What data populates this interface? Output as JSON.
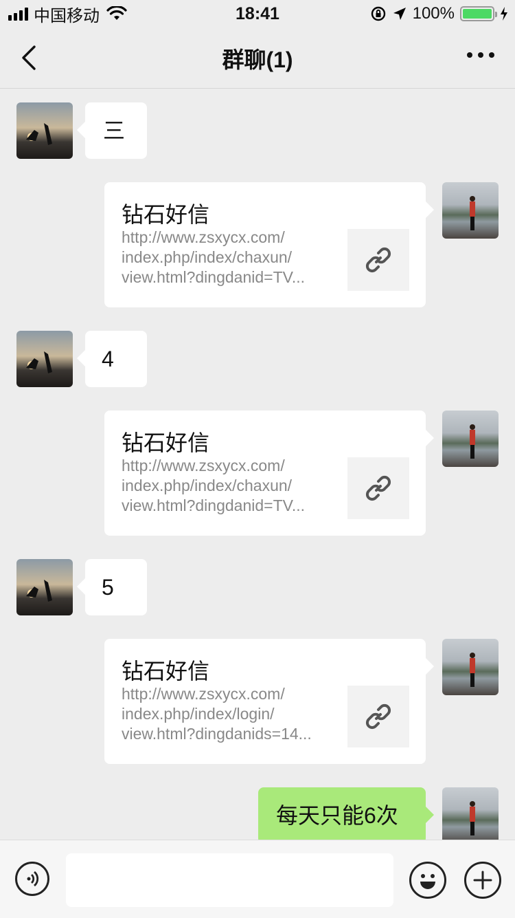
{
  "status_bar": {
    "carrier": "中国移动",
    "time": "18:41",
    "battery": "100%",
    "battery_level": 1.0
  },
  "nav": {
    "title": "群聊(1)"
  },
  "messages": [
    {
      "side": "left",
      "type": "text",
      "text": "三"
    },
    {
      "side": "right",
      "type": "link",
      "title": "钻石好信",
      "url_lines": [
        "http://www.zsxycx.com/",
        "index.php/index/chaxun/",
        "view.html?dingdanid=TV..."
      ]
    },
    {
      "side": "left",
      "type": "text",
      "text": "4"
    },
    {
      "side": "right",
      "type": "link",
      "title": "钻石好信",
      "url_lines": [
        "http://www.zsxycx.com/",
        "index.php/index/chaxun/",
        "view.html?dingdanid=TV..."
      ]
    },
    {
      "side": "left",
      "type": "text",
      "text": "5"
    },
    {
      "side": "right",
      "type": "link",
      "title": "钻石好信",
      "url_lines": [
        "http://www.zsxycx.com/",
        "index.php/index/login/",
        "view.html?dingdanids=14..."
      ]
    },
    {
      "side": "right",
      "type": "text",
      "text": "每天只能6次"
    }
  ],
  "input": {
    "value": "",
    "placeholder": ""
  },
  "colors": {
    "background": "#ededed",
    "self_bubble": "#a9e97a",
    "other_bubble": "#ffffff",
    "battery_fill": "#4cd964"
  },
  "icons": [
    "back-icon",
    "more-icon",
    "signal-icon",
    "wifi-icon",
    "lock-rotation-icon",
    "location-icon",
    "battery-icon",
    "charging-icon",
    "link-icon",
    "voice-icon",
    "emoji-icon",
    "plus-icon"
  ]
}
